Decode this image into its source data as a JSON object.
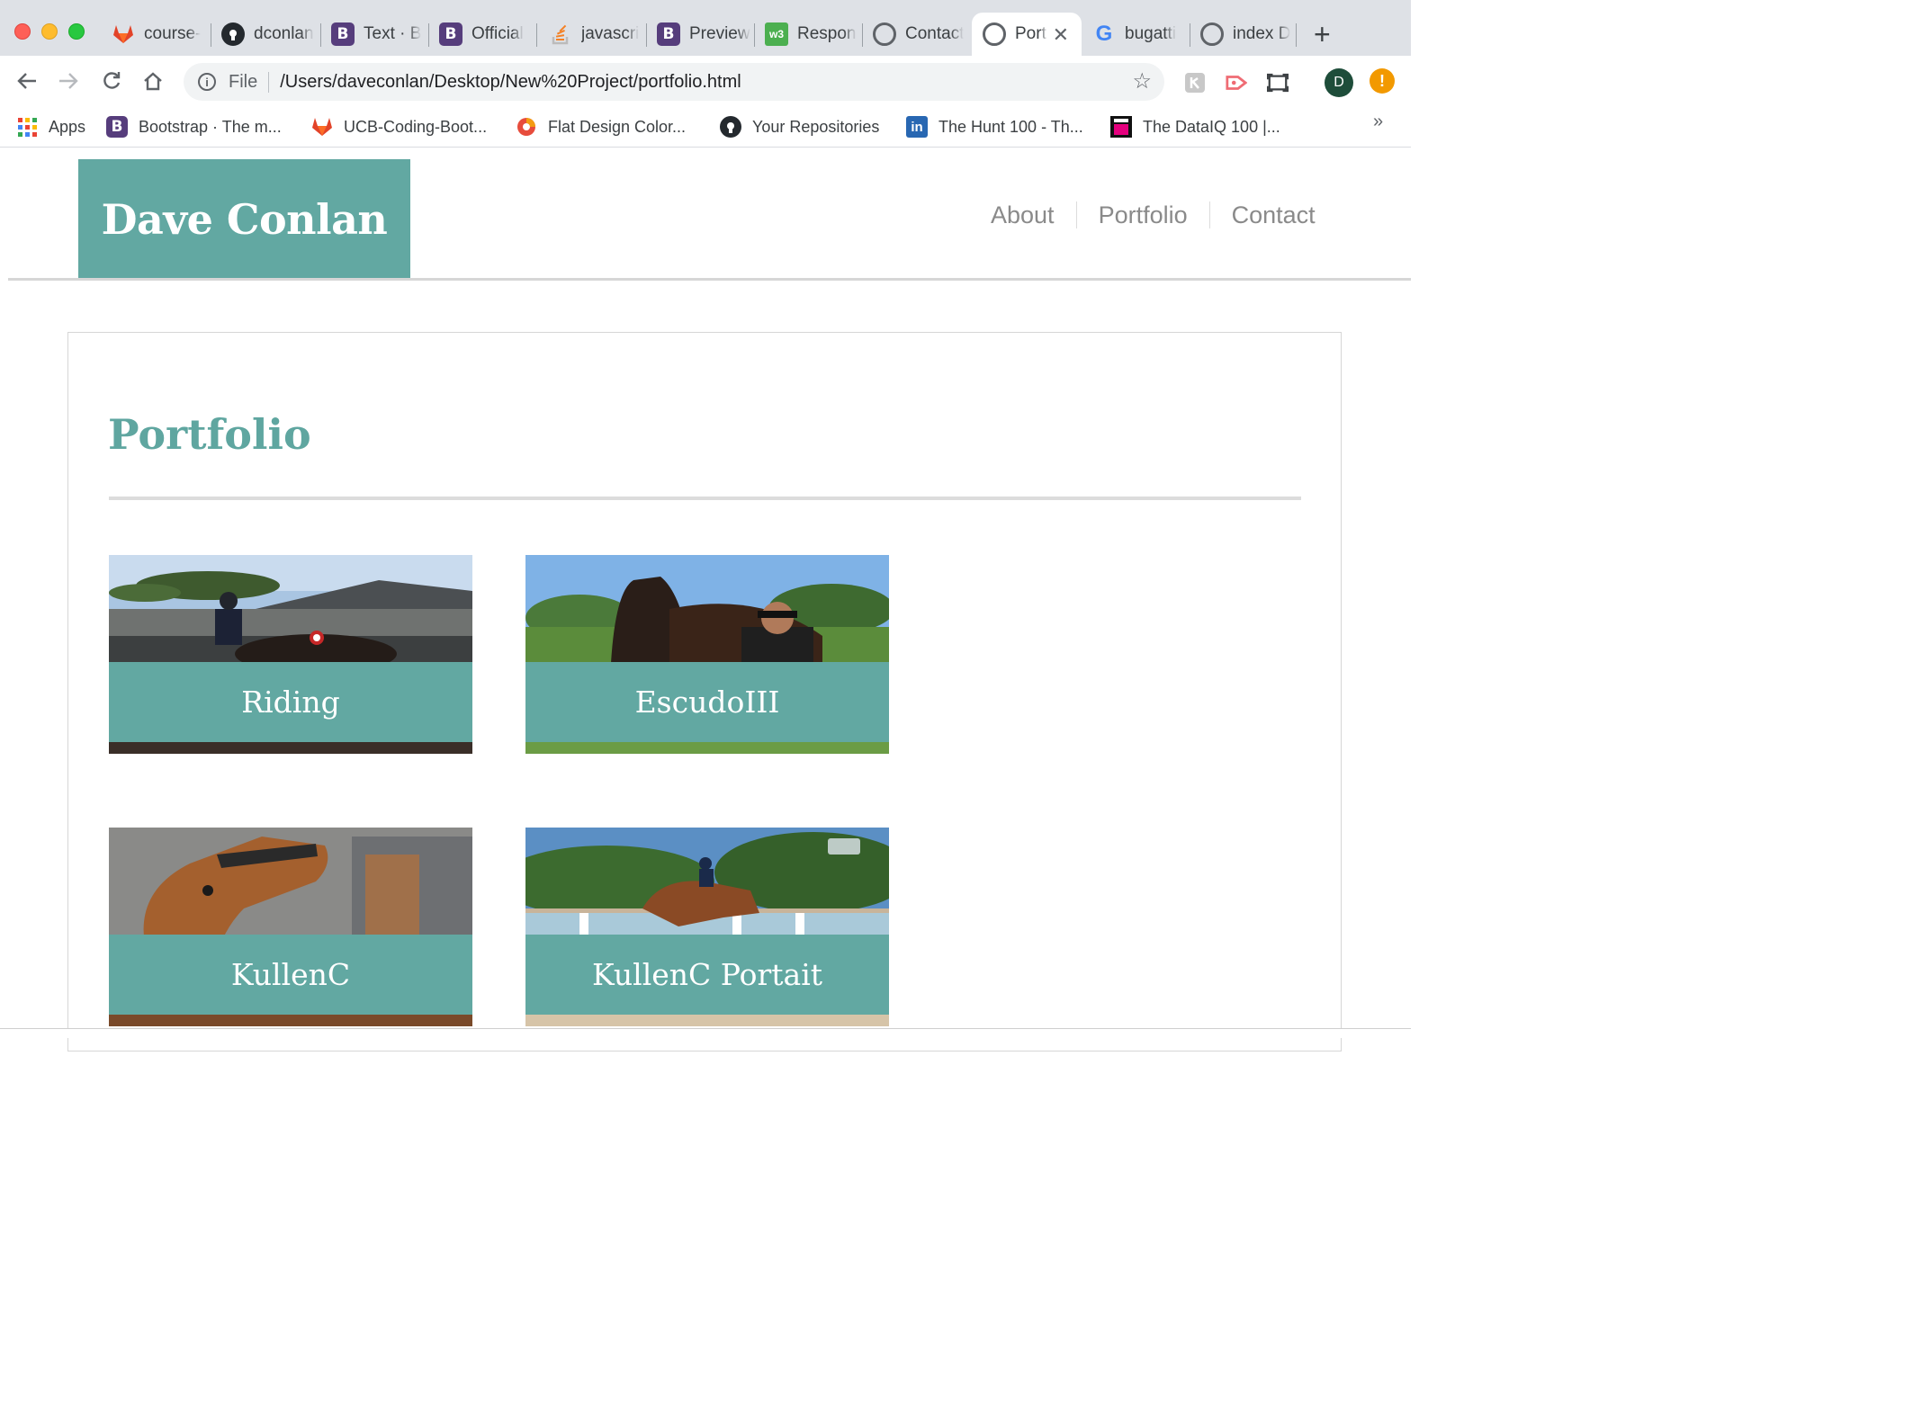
{
  "browser": {
    "tabs": [
      {
        "title": "course-",
        "icon": "gitlab-icon"
      },
      {
        "title": "dconlan",
        "icon": "github-icon"
      },
      {
        "title": "Text · B",
        "icon": "bootstrap-icon"
      },
      {
        "title": "Official",
        "icon": "bootstrap-icon"
      },
      {
        "title": "javascri",
        "icon": "stackoverflow-icon"
      },
      {
        "title": "Preview",
        "icon": "bootstrap-icon"
      },
      {
        "title": "Respon",
        "icon": "w3schools-icon"
      },
      {
        "title": "Contact",
        "icon": "globe-icon"
      },
      {
        "title": "Port",
        "icon": "globe-icon",
        "active": true
      },
      {
        "title": "bugatti",
        "icon": "google-icon"
      },
      {
        "title": "index D",
        "icon": "globe-icon"
      }
    ],
    "bootstrap_glyph": "B",
    "w3_glyph": "w3",
    "google_glyph": "G",
    "omnibox": {
      "scheme_label": "File",
      "url": "/Users/daveconlan/Desktop/New%20Project/portfolio.html"
    },
    "profile_initial": "D",
    "alert_glyph": "!",
    "bookmarks": [
      {
        "label": "Apps",
        "icon": "apps-grid-icon"
      },
      {
        "label": "Bootstrap · The m...",
        "icon": "bootstrap-icon"
      },
      {
        "label": "UCB-Coding-Boot...",
        "icon": "gitlab-icon"
      },
      {
        "label": "Flat Design Color...",
        "icon": "color-wheel-icon"
      },
      {
        "label": "Your Repositories",
        "icon": "github-icon"
      },
      {
        "label": "The Hunt 100 - Th...",
        "icon": "linkedin-icon"
      },
      {
        "label": "The DataIQ 100 |...",
        "icon": "dataiq-icon"
      }
    ],
    "linkedin_glyph": "in",
    "bookmarks_overflow": "»"
  },
  "site": {
    "brand": "Dave Conlan",
    "nav": [
      "About",
      "Portfolio",
      "Contact"
    ],
    "heading": "Portfolio",
    "tiles": [
      {
        "caption": "Riding"
      },
      {
        "caption": "EscudoIII"
      },
      {
        "caption": "KullenC"
      },
      {
        "caption": "KullenC Portait"
      }
    ]
  },
  "colors": {
    "accent": "#62a8a2",
    "heading": "#5fa6a0",
    "nav_text": "#8a8a8a"
  }
}
